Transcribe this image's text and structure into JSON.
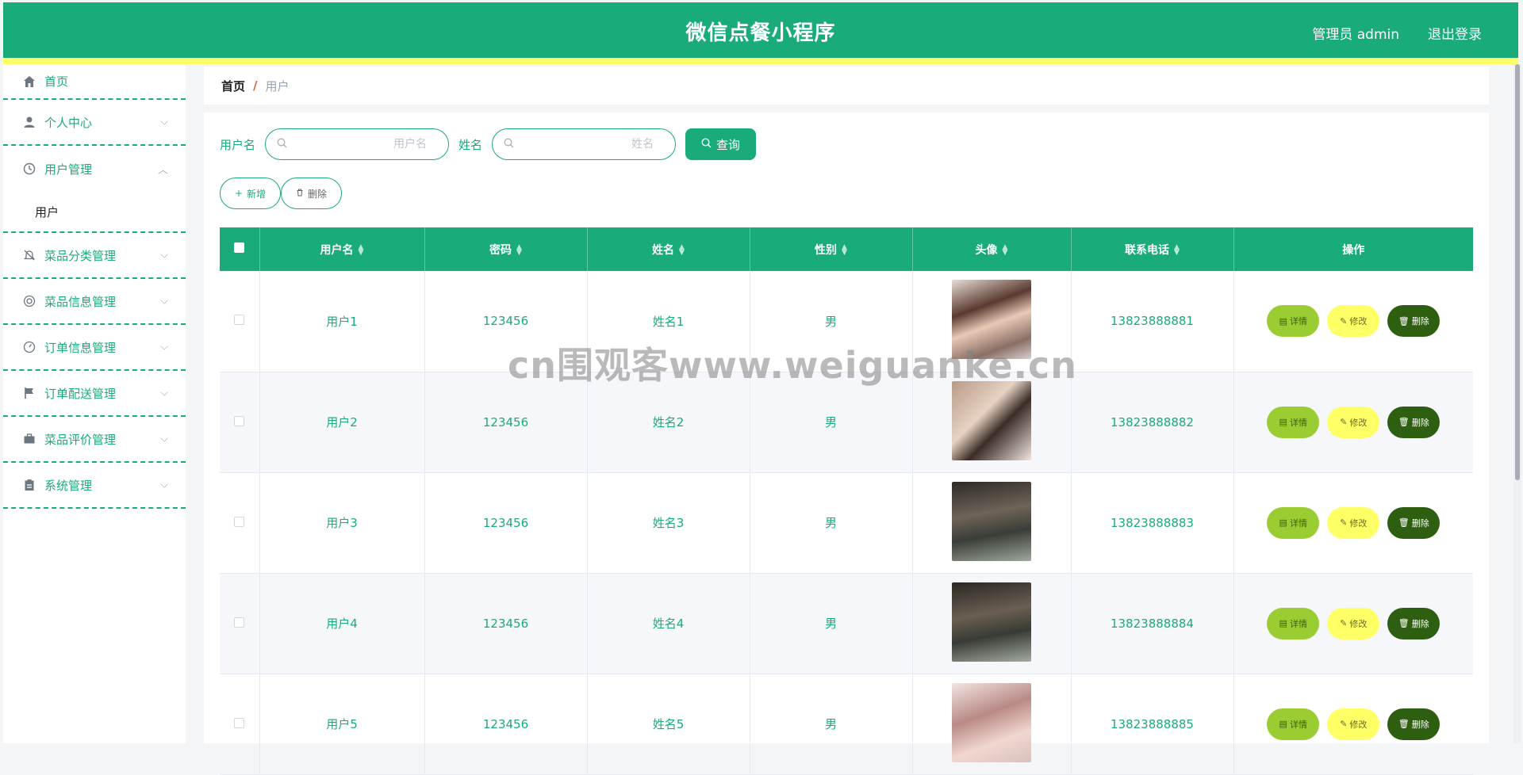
{
  "header": {
    "title": "微信点餐小程序",
    "user": "管理员 admin",
    "logout": "退出登录"
  },
  "sidebar": {
    "items": [
      {
        "label": "首页",
        "icon": "home-icon"
      },
      {
        "label": "个人中心",
        "icon": "user-icon"
      },
      {
        "label": "用户管理",
        "icon": "clock-icon",
        "expanded": true,
        "children": [
          "用户"
        ]
      },
      {
        "label": "菜品分类管理",
        "icon": "bell-off-icon"
      },
      {
        "label": "菜品信息管理",
        "icon": "lifebuoy-icon"
      },
      {
        "label": "订单信息管理",
        "icon": "gauge-icon"
      },
      {
        "label": "订单配送管理",
        "icon": "flag-icon"
      },
      {
        "label": "菜品评价管理",
        "icon": "briefcase-icon"
      },
      {
        "label": "系统管理",
        "icon": "clipboard-icon"
      }
    ]
  },
  "breadcrumb": {
    "home": "首页",
    "separator": "/",
    "current": "用户"
  },
  "search": {
    "username_label": "用户名",
    "username_placeholder": "用户名",
    "name_label": "姓名",
    "name_placeholder": "姓名",
    "query_button": "查询"
  },
  "actions": {
    "add": "新增",
    "delete": "删除"
  },
  "table": {
    "headers": [
      "用户名",
      "密码",
      "姓名",
      "性别",
      "头像",
      "联系电话",
      "操作"
    ],
    "rows": [
      {
        "username": "用户1",
        "password": "123456",
        "name": "姓名1",
        "gender": "男",
        "phone": "13823888881"
      },
      {
        "username": "用户2",
        "password": "123456",
        "name": "姓名2",
        "gender": "男",
        "phone": "13823888882"
      },
      {
        "username": "用户3",
        "password": "123456",
        "name": "姓名3",
        "gender": "男",
        "phone": "13823888883"
      },
      {
        "username": "用户4",
        "password": "123456",
        "name": "姓名4",
        "gender": "男",
        "phone": "13823888884"
      },
      {
        "username": "用户5",
        "password": "123456",
        "name": "姓名5",
        "gender": "男",
        "phone": "13823888885"
      }
    ],
    "ops": {
      "detail": "详情",
      "edit": "修改",
      "delete": "删除"
    }
  },
  "watermark": "cn围观客www.weiguanke.cn",
  "colors": {
    "primary": "#1aab7a",
    "accent_yellow": "#ffff66",
    "detail_green": "#9acd32",
    "delete_dark": "#2e5e0f"
  }
}
